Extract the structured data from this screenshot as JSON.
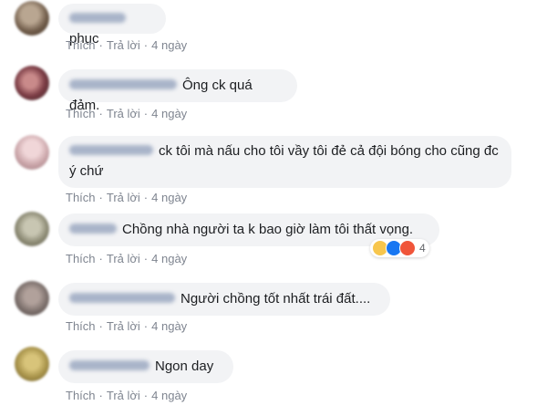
{
  "comments": [
    {
      "text": "phục",
      "actions": {
        "like": "Thích",
        "reply": "Trả lời",
        "time": "4 ngày"
      },
      "avatar_color": "#7b6a58"
    },
    {
      "text": "Ông ck quá đảm.",
      "actions": {
        "like": "Thích",
        "reply": "Trả lời",
        "time": "4 ngày"
      },
      "avatar_color": "#8a4a52"
    },
    {
      "text": "ck tôi mà nấu cho tôi vầy tôi đẻ cả đội bóng cho cũng đc ý chứ",
      "actions": {
        "like": "Thích",
        "reply": "Trả lời",
        "time": "4 ngày"
      },
      "avatar_color": "#c9a4a8"
    },
    {
      "text": "Chồng nhà người ta k bao giờ làm tôi thất vọng.",
      "actions": {
        "like": "Thích",
        "reply": "Trả lời",
        "time": "4 ngày"
      },
      "avatar_color": "#8c8a74",
      "reactions": {
        "count": "4",
        "icons": [
          "haha-icon",
          "like-icon",
          "angry-icon"
        ]
      }
    },
    {
      "text": "Người chồng tốt nhất trái đất....",
      "actions": {
        "like": "Thích",
        "reply": "Trả lời",
        "time": "4 ngày"
      },
      "avatar_color": "#7a6e6a"
    },
    {
      "text": "Ngon day",
      "actions": {
        "like": "Thích",
        "reply": "Trả lời",
        "time": "4 ngày"
      },
      "avatar_color": "#a8934a"
    }
  ],
  "colors": {
    "bubble": "#f2f3f5",
    "action_text": "#7f8590",
    "comment_text": "#1c1e21"
  }
}
